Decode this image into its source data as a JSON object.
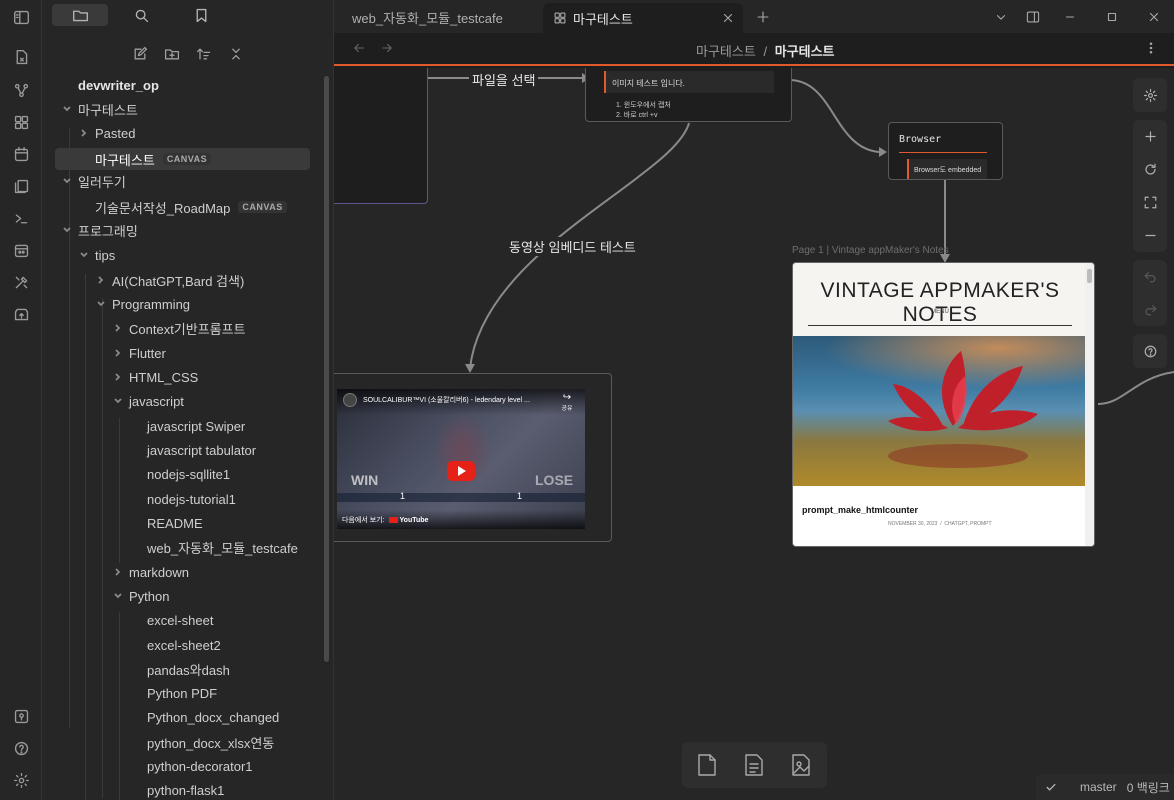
{
  "sidebar": {
    "vault_name": "devwriter_op",
    "tree": [
      {
        "label": "마구테스트",
        "open": true
      },
      {
        "label": "Pasted",
        "open": false
      },
      {
        "label": "마구테스트",
        "badge": "CANVAS"
      },
      {
        "label": "일러두기",
        "open": true
      },
      {
        "label": "기술문서작성_RoadMap",
        "badge": "CANVAS"
      },
      {
        "label": "프로그래밍",
        "open": true
      },
      {
        "label": "tips",
        "open": true
      },
      {
        "label": "AI(ChatGPT,Bard 검색)",
        "open": false
      },
      {
        "label": "Programming",
        "open": true
      },
      {
        "label": "Context기반프롬프트",
        "open": false
      },
      {
        "label": "Flutter",
        "open": false
      },
      {
        "label": "HTML_CSS",
        "open": false
      },
      {
        "label": "javascript",
        "open": true
      },
      {
        "label": "javascript Swiper"
      },
      {
        "label": "javascript tabulator"
      },
      {
        "label": "nodejs-sqllite1"
      },
      {
        "label": "nodejs-tutorial1"
      },
      {
        "label": "README"
      },
      {
        "label": "web_자동화_모듈_testcafe"
      },
      {
        "label": "markdown",
        "open": false
      },
      {
        "label": "Python",
        "open": true
      },
      {
        "label": "excel-sheet"
      },
      {
        "label": "excel-sheet2"
      },
      {
        "label": "pandas와dash"
      },
      {
        "label": "Python PDF"
      },
      {
        "label": "Python_docx_changed"
      },
      {
        "label": "python_docx_xlsx연동"
      },
      {
        "label": "python-decorator1"
      },
      {
        "label": "python-flask1"
      }
    ]
  },
  "tabs": [
    {
      "label": "web_자동화_모듈_testcafe"
    },
    {
      "label": "마구테스트"
    }
  ],
  "breadcrumb": {
    "parent": "마구테스트",
    "separator": "/",
    "current": "마구테스트"
  },
  "canvas": {
    "edge_select_file": "파일을 선택",
    "edge_video_test": "동영상 임베디드 테스트",
    "note_text": "이미지 테스트 입니다.",
    "note_list": [
      "윈도우에서 캡처",
      "바로 ctrl +v"
    ],
    "browser_title": "Browser",
    "browser_line": "Browser도 embedded",
    "web_caption": "Page 1 | Vintage appMaker's Notes",
    "web_heading": "VINTAGE APPMAKER'S NOTES",
    "web_menu": "MENU",
    "web_post_title": "prompt_make_htmlcounter",
    "web_post_meta": "NOVEMBER 30, 2023  /  CHATGPT, PROMPT",
    "video_title": "SOULCALIBUR™VI (소울칼리버6) - ledendary level ...",
    "video_share": "공유",
    "video_win": "WIN",
    "video_lose": "LOSE",
    "video_score_left": "1",
    "video_score_right": "1",
    "video_watch_on": "다음에서 보기:",
    "video_brand": "YouTube"
  },
  "status": {
    "branch": "master",
    "backlinks": "0 백링크"
  },
  "colors": {
    "accent": "#e05a2b",
    "background": "#262626"
  }
}
